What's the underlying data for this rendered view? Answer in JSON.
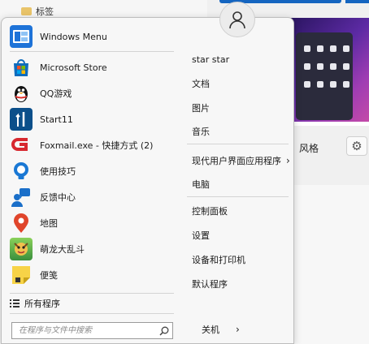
{
  "background": {
    "tag_label": "标签",
    "style_label": "风格"
  },
  "start_menu": {
    "programs": [
      {
        "label": "Windows Menu",
        "icon": "windows-menu-icon",
        "color": "#1e73d8"
      },
      {
        "label": "Microsoft Store",
        "icon": "microsoft-store-icon",
        "color": "#0f6cbd"
      },
      {
        "label": "QQ游戏",
        "icon": "qq-penguin-icon",
        "color": "#111111"
      },
      {
        "label": "Start11",
        "icon": "start11-icon",
        "color": "#0b4f8a"
      },
      {
        "label": "Foxmail.exe - 快捷方式 (2)",
        "icon": "foxmail-icon",
        "color": "#d7282f"
      },
      {
        "label": "使用技巧",
        "icon": "tips-bulb-icon",
        "color": "#1a78d4"
      },
      {
        "label": "反馈中心",
        "icon": "feedback-hub-icon",
        "color": "#1a6fc9"
      },
      {
        "label": "地图",
        "icon": "maps-pin-icon",
        "color": "#e0452b"
      },
      {
        "label": "萌龙大乱斗",
        "icon": "dragon-game-icon",
        "color": "#6bb548"
      },
      {
        "label": "便笺",
        "icon": "sticky-notes-icon",
        "color": "#f7d347"
      }
    ],
    "all_programs_label": "所有程序",
    "search_placeholder": "在程序与文件中搜索",
    "right_items": {
      "user": "star star",
      "documents": "文档",
      "pictures": "图片",
      "music": "音乐",
      "modern_apps": "现代用户界面应用程序",
      "computer": "电脑",
      "control_panel": "控制面板",
      "settings": "设置",
      "devices_printers": "设备和打印机",
      "default_programs": "默认程序"
    },
    "shutdown_label": "关机"
  }
}
